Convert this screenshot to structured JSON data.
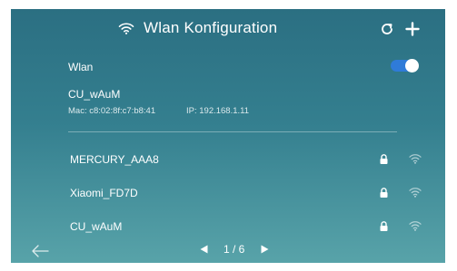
{
  "header": {
    "title": "Wlan Konfiguration",
    "title_icon": "wifi-icon",
    "refresh_icon": "refresh-icon",
    "add_icon": "plus-icon"
  },
  "wlan": {
    "label": "Wlan",
    "enabled": true
  },
  "connected": {
    "ssid": "CU_wAuM",
    "mac": "Mac: c8:02:8f:c7:b8:41",
    "ip": "IP: 192.168.1.11"
  },
  "networks": [
    {
      "ssid": "MERCURY_AAA8",
      "lock_icon": "lock-icon",
      "signal_icon": "wifi-signal-icon"
    },
    {
      "ssid": "Xiaomi_FD7D",
      "lock_icon": "lock-icon",
      "signal_icon": "wifi-signal-icon"
    },
    {
      "ssid": "CU_wAuM",
      "lock_icon": "lock-icon",
      "signal_icon": "wifi-signal-icon"
    }
  ],
  "pagination": {
    "text": "1 / 6",
    "prev_icon": "triangle-left-icon",
    "next_icon": "triangle-right-icon"
  },
  "footer": {
    "back_icon": "arrow-left-icon"
  },
  "colors": {
    "background_top": "#2b6f82",
    "background_bottom": "#58a3a9",
    "toggle_on": "#2f7bd8",
    "text": "#ffffff"
  }
}
